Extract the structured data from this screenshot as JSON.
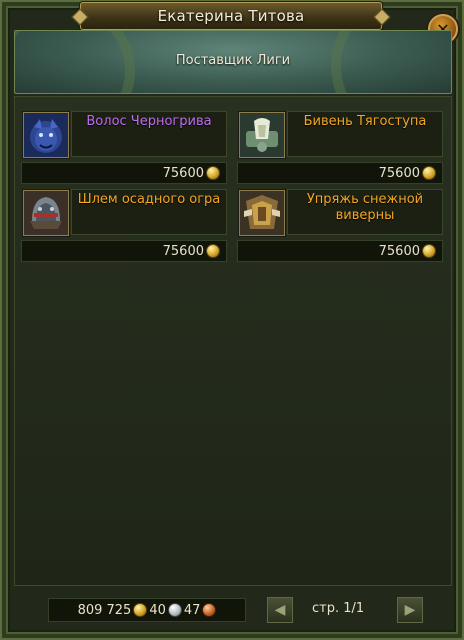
{
  "window": {
    "title": "Екатерина Титова",
    "subtitle": "Поставщик Лиги"
  },
  "items": [
    {
      "name": "Волос Черногрива",
      "price": "75600",
      "color": "#c06cf0",
      "icon": "panther-icon"
    },
    {
      "name": "Бивень Тягоступа",
      "price": "75600",
      "color": "#f3a623",
      "icon": "tusk-icon"
    },
    {
      "name": "Шлем осадного огра",
      "price": "75600",
      "color": "#f3a623",
      "icon": "helmet-icon"
    },
    {
      "name": "Упряжь снежной виверны",
      "price": "75600",
      "color": "#f3a623",
      "icon": "harness-icon"
    }
  ],
  "currency": {
    "gold": "809 725",
    "silver": "40",
    "copper": "47"
  },
  "pagination": {
    "label": "стр. 1/1"
  },
  "colors": {
    "epic": "#c06cf0",
    "legendary": "#f3a623"
  }
}
